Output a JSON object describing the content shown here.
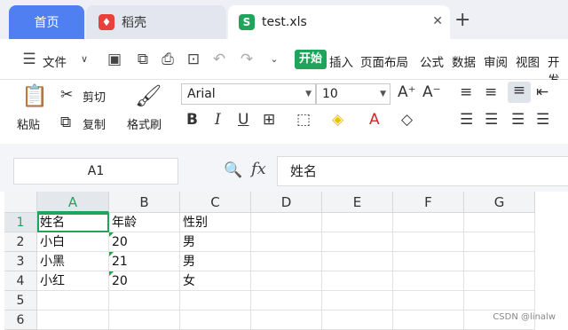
{
  "tabs": {
    "home": "首页",
    "docer": "稻壳",
    "file": "test.xls",
    "new_tab": "+"
  },
  "menu": {
    "file": "文件",
    "start": "开始",
    "insert": "插入",
    "page_layout": "页面布局",
    "formulas": "公式",
    "data": "数据",
    "review": "审阅",
    "view": "视图",
    "dev": "开发"
  },
  "ribbon": {
    "paste": "粘贴",
    "cut": "剪切",
    "copy": "复制",
    "format_painter": "格式刷",
    "font_name": "Arial",
    "font_size": "10"
  },
  "formula_bar": {
    "name_box": "A1",
    "content": "姓名"
  },
  "sheet": {
    "columns": [
      "A",
      "B",
      "C",
      "D",
      "E",
      "F",
      "G"
    ],
    "rows": [
      "1",
      "2",
      "3",
      "4",
      "5",
      "6"
    ],
    "cells": [
      [
        "姓名",
        "年龄",
        "性别"
      ],
      [
        "小白",
        "20",
        "男"
      ],
      [
        "小黑",
        "21",
        "男"
      ],
      [
        "小红",
        "20",
        "女"
      ]
    ]
  },
  "watermark": "CSDN @linalw"
}
